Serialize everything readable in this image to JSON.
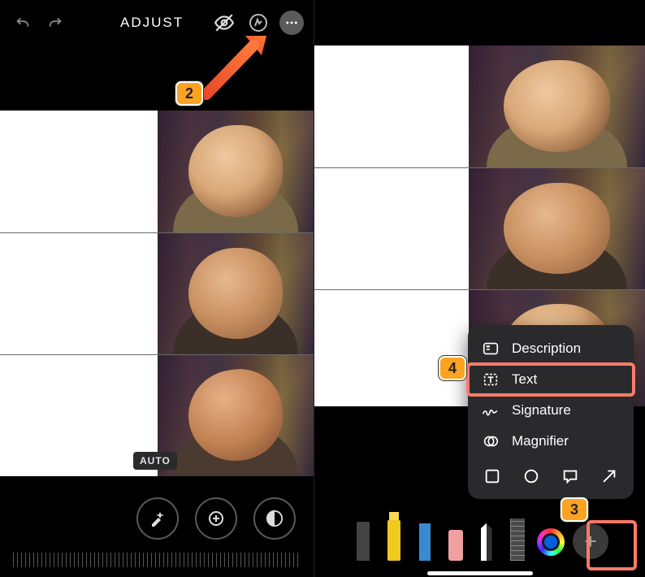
{
  "left": {
    "title": "ADJUST",
    "auto_chip": "AUTO"
  },
  "popover": {
    "items": [
      {
        "label": "Description"
      },
      {
        "label": "Text"
      },
      {
        "label": "Signature"
      },
      {
        "label": "Magnifier"
      }
    ]
  },
  "annotations": {
    "badge2": "2",
    "badge3": "3",
    "badge4": "4"
  },
  "colors": {
    "highlight": "#ff7a6a",
    "badge": "#fca321"
  }
}
